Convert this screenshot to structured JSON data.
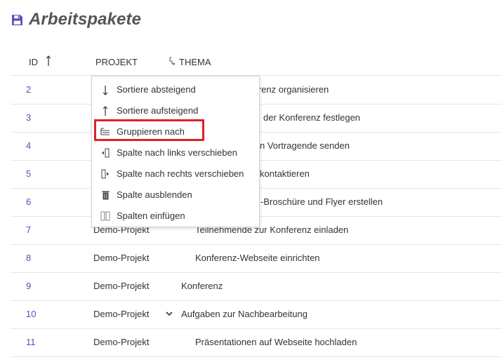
{
  "page": {
    "title": "Arbeitspakete",
    "title_icon": "floppy-disk-icon",
    "accent_color": "#5a4bbd",
    "highlight_color": "#e0202a"
  },
  "table": {
    "columns": {
      "id": "ID",
      "project": "PROJEKT",
      "subject": "THEMA"
    },
    "sort": {
      "column": "ID",
      "direction": "ascending"
    },
    "rows": [
      {
        "id": "2",
        "project": "",
        "subject": "ferenz organisieren"
      },
      {
        "id": "3",
        "project": "",
        "subject": "der Konferenz festlegen"
      },
      {
        "id": "4",
        "project": "",
        "subject": "n Vortragende senden"
      },
      {
        "id": "5",
        "project": "",
        "subject": "kontaktieren"
      },
      {
        "id": "6",
        "project": "",
        "subject": "-Broschüre und Flyer erstellen"
      },
      {
        "id": "7",
        "project": "Demo-Projekt",
        "subject": "Teilnehmende zur Konferenz einladen"
      },
      {
        "id": "8",
        "project": "Demo-Projekt",
        "subject": "Konferenz-Webseite einrichten"
      },
      {
        "id": "9",
        "project": "Demo-Projekt",
        "subject": "Konferenz"
      },
      {
        "id": "10",
        "project": "Demo-Projekt",
        "subject": "Aufgaben zur Nachbearbeitung"
      },
      {
        "id": "11",
        "project": "Demo-Projekt",
        "subject": "Präsentationen auf Webseite hochladen"
      }
    ]
  },
  "context_menu": {
    "items": [
      {
        "label": "Sortiere absteigend",
        "icon": "arrow-down-icon"
      },
      {
        "label": "Sortiere aufsteigend",
        "icon": "arrow-up-icon"
      },
      {
        "label": "Gruppieren nach",
        "icon": "group-by-icon",
        "highlighted": true
      },
      {
        "label": "Spalte nach links verschieben",
        "icon": "move-left-icon"
      },
      {
        "label": "Spalte nach rechts verschieben",
        "icon": "move-right-icon"
      },
      {
        "label": "Spalte ausblenden",
        "icon": "trash-icon"
      },
      {
        "label": "Spalten einfügen",
        "icon": "columns-icon"
      }
    ]
  }
}
